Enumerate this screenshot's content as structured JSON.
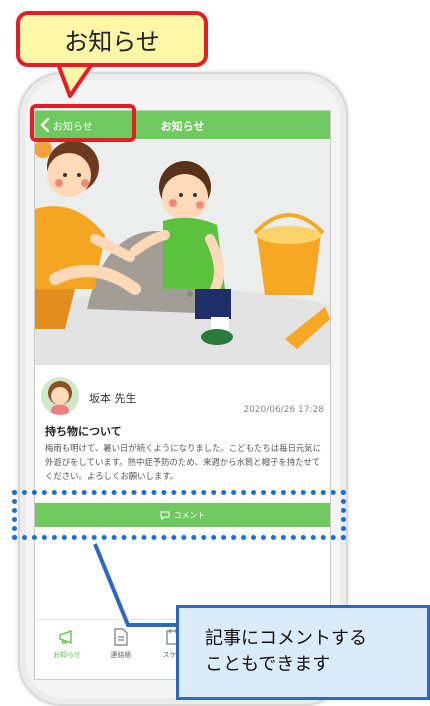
{
  "callouts": {
    "top_label": "お知らせ",
    "comment_note_line1": "記事にコメントする",
    "comment_note_line2": "こともできます"
  },
  "header": {
    "back_label": "お知らせ",
    "title": "お知らせ"
  },
  "post": {
    "author": "坂本 先生",
    "date": "2020/06/26 17:28",
    "title": "持ち物について",
    "body": "梅雨も明けて、暑い日が続くようになりました。こどもたちは毎日元気に外遊びをしています。熱中症予防のため、来週から水筒と帽子を持たせてください。よろしくお願いします。",
    "comment_label": "コメント"
  },
  "tabbar": {
    "items": [
      {
        "label": "お知らせ",
        "icon": "megaphone-icon",
        "active": true
      },
      {
        "label": "連絡帳",
        "icon": "notebook-icon",
        "active": false
      },
      {
        "label": "スケジ",
        "icon": "calendar-icon",
        "active": false
      }
    ]
  },
  "colors": {
    "accent_green": "#6fc95f",
    "highlight_red": "#e21f26",
    "callout_yellow": "#fff7a8",
    "callout_blue_fill": "#dcebfa",
    "callout_blue_border": "#2f68c4"
  }
}
